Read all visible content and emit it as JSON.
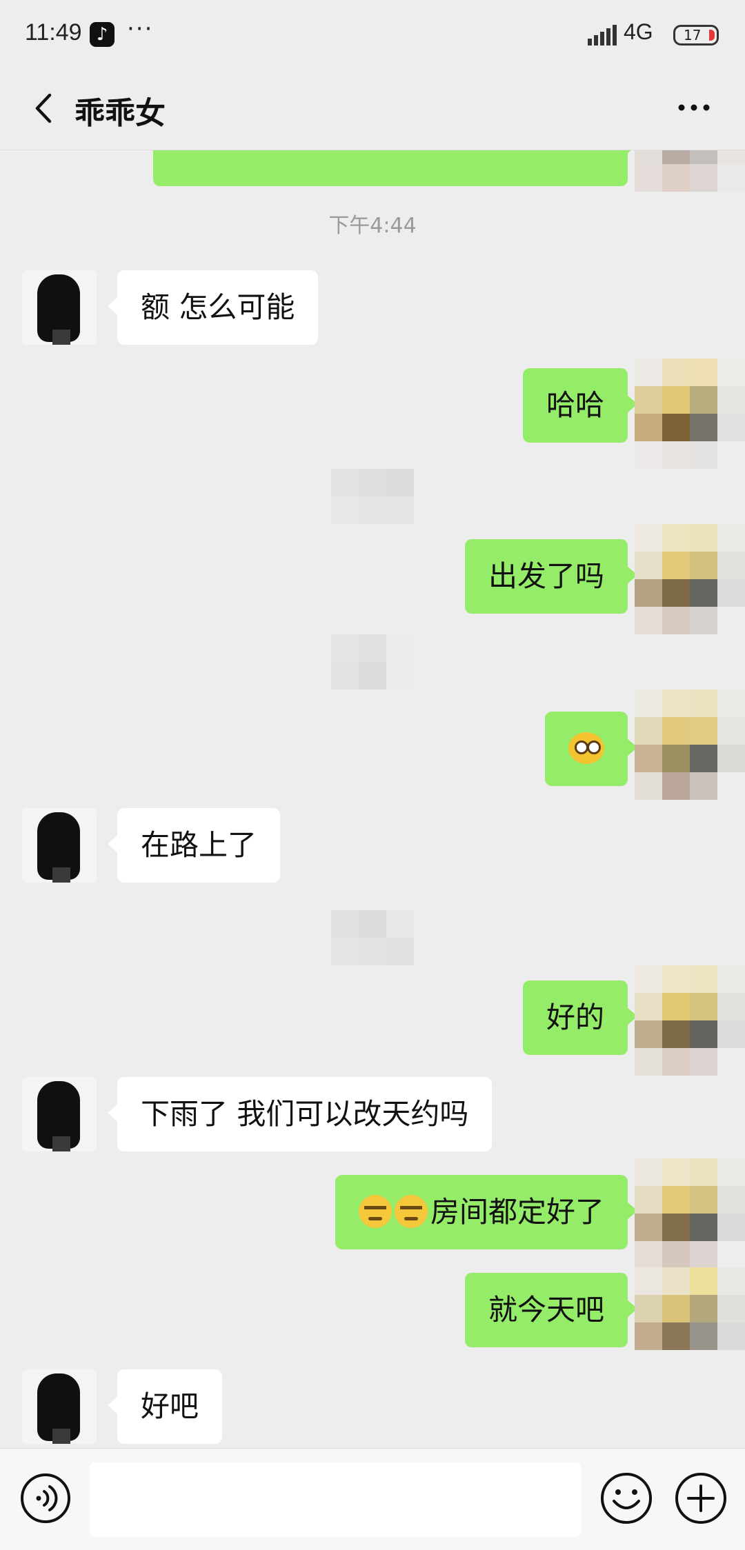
{
  "status_bar": {
    "time": "11:49",
    "app_icon": "tiktok-icon",
    "app_glyph": "♪",
    "dots": "···",
    "network": "4G",
    "battery": "17"
  },
  "header": {
    "back_icon": "back-arrow-icon",
    "title": "乖乖女",
    "more_icon": "more-icon"
  },
  "messages": [
    {
      "type": "timestamp",
      "text": "下午4:44"
    },
    {
      "type": "in",
      "text": "额  怎么可能"
    },
    {
      "type": "out",
      "text": "哈哈"
    },
    {
      "type": "out",
      "text": "出发了吗"
    },
    {
      "type": "out",
      "emoji": [
        "dizzy-emoji"
      ]
    },
    {
      "type": "in",
      "text": "在路上了"
    },
    {
      "type": "out",
      "text": "好的"
    },
    {
      "type": "in",
      "text": "下雨了  我们可以改天约吗"
    },
    {
      "type": "out",
      "emoji": [
        "sweat-emoji",
        "sweat-emoji"
      ],
      "text": "房间都定好了"
    },
    {
      "type": "out",
      "text": "就今天吧"
    },
    {
      "type": "in",
      "text": "好吧"
    }
  ],
  "input_bar": {
    "voice_icon": "voice-icon",
    "placeholder": "",
    "emoji_icon": "emoji-icon",
    "plus_icon": "plus-icon"
  },
  "colors": {
    "background": "#ededed",
    "bubble_out": "#95ec69",
    "bubble_in": "#ffffff",
    "timestamp": "#9a9a9a"
  }
}
